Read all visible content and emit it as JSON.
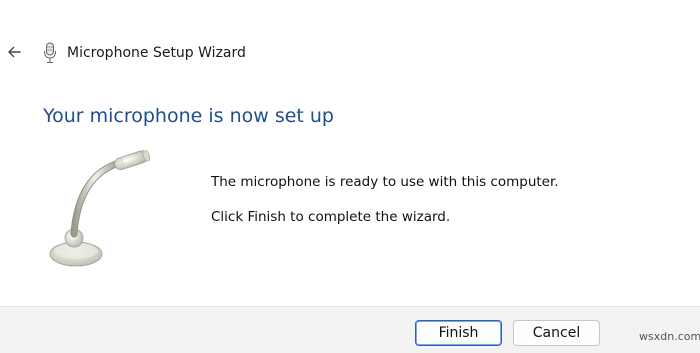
{
  "header": {
    "back_icon": "arrow-left-icon",
    "app_icon": "microphone-icon",
    "title": "Microphone Setup Wizard"
  },
  "main": {
    "heading": "Your microphone is now set up",
    "illustration_icon": "desk-microphone-icon",
    "message_1": "The microphone is ready to use with this computer.",
    "message_2": "Click Finish to complete the wizard."
  },
  "footer": {
    "finish_label": "Finish",
    "cancel_label": "Cancel"
  },
  "watermark": "wsxdn.com",
  "colors": {
    "heading": "#1f4e8f",
    "footer_bg": "#f3f3f3",
    "primary_border": "#2b62b8"
  }
}
